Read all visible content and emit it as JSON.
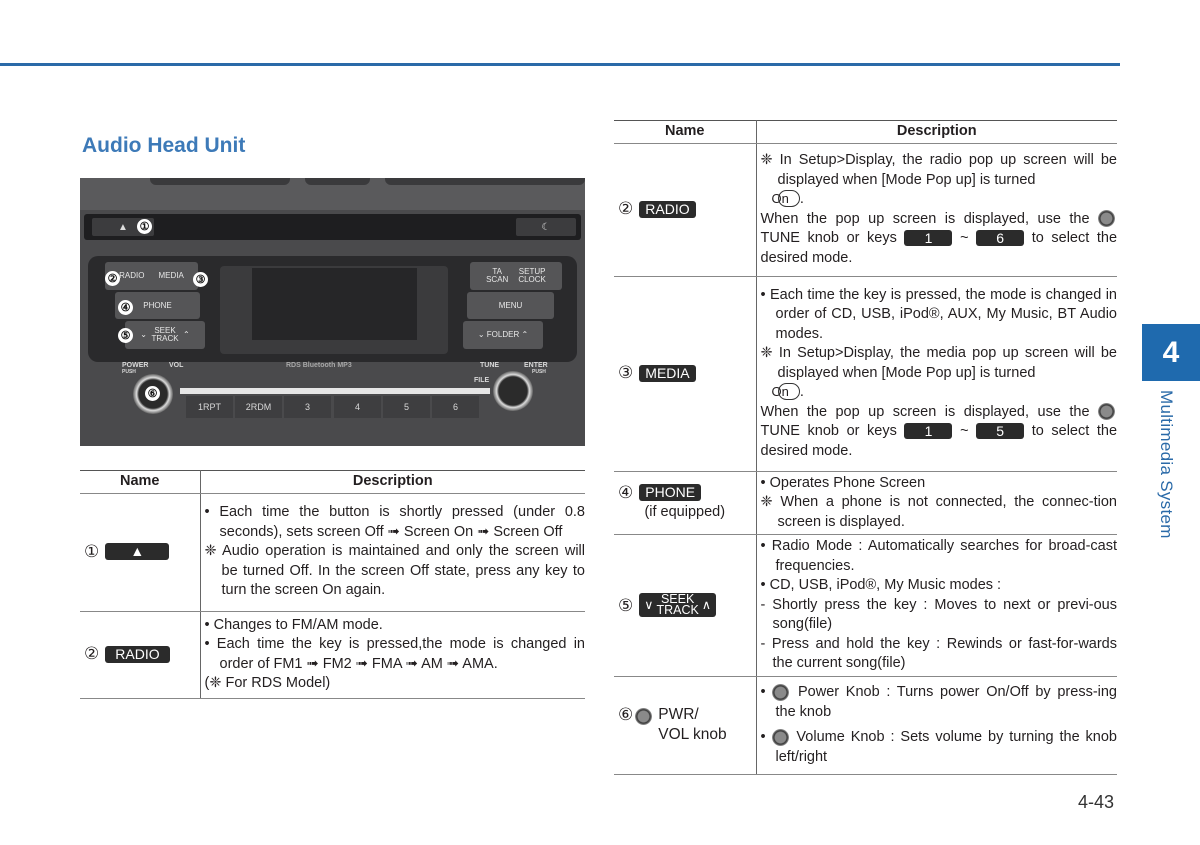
{
  "section_title": "Audio Head Unit",
  "chapter": {
    "number": "4",
    "label": "Multimedia System"
  },
  "page_number": "4-43",
  "colors": {
    "accent": "#2a6aa8",
    "tab": "#1f6aae",
    "key_badge": "#2b2b2b"
  },
  "photo": {
    "callouts": [
      "①",
      "②",
      "③",
      "④",
      "⑤",
      "⑥"
    ],
    "buttons": {
      "radio": "RADIO",
      "media": "MEDIA",
      "phone": "PHONE",
      "seek_top": "SEEK",
      "seek_bottom": "TRACK",
      "ta_top": "TA",
      "ta_bottom": "SCAN",
      "setup_top": "SETUP",
      "setup_bottom": "CLOCK",
      "menu": "MENU",
      "folder": "FOLDER"
    },
    "labels": {
      "power": "POWER",
      "power_push": "PUSH",
      "vol": "VOL",
      "brands": "RDS  Bluetooth  MP3",
      "tune": "TUNE",
      "enter": "ENTER",
      "enter_push": "PUSH",
      "file": "FILE"
    },
    "presets": [
      "1RPT",
      "2RDM",
      "3",
      "4",
      "5",
      "6"
    ]
  },
  "table_headers": {
    "name": "Name",
    "description": "Description"
  },
  "left_table": {
    "rows": [
      {
        "num": "①",
        "key": "▲",
        "lines": [
          "• Each time the button is shortly pressed (under 0.8 seconds), sets screen Off ➟ Screen On ➟ Screen Off",
          "❈ Audio operation is maintained and only the screen will be turned Off. In the screen Off state, press any key to turn the screen On again."
        ]
      },
      {
        "num": "②",
        "key": "RADIO",
        "lines": [
          "• Changes to FM/AM mode.",
          "• Each time the key is pressed,the mode is changed in order of FM1 ➟ FM2 ➟ FMA ➟ AM ➟ AMA.",
          "(❈ For RDS Model)"
        ]
      }
    ]
  },
  "right_table": {
    "radio": {
      "num": "②",
      "key": "RADIO",
      "note": "❈ In Setup>Display, the radio pop up screen will be displayed when [Mode Pop up] is turned",
      "on_pill": "On",
      "period": ".",
      "para_a": "When the pop up screen is displayed, use the",
      "para_b": "TUNE knob or keys",
      "key_from": "1",
      "tilde": "~",
      "key_to": "6",
      "para_c": "to select the desired mode."
    },
    "media": {
      "num": "③",
      "key": "MEDIA",
      "bullet": "• Each time the key is pressed, the mode is changed in order of CD, USB, iPod®, AUX, My Music, BT Audio modes.",
      "note": "❈ In Setup>Display, the media pop up screen will be displayed when [Mode Pop up] is turned",
      "on_pill": "On",
      "period": ".",
      "para_a": "When the pop up screen is displayed, use the",
      "para_b": "TUNE knob or keys",
      "key_from": "1",
      "tilde": "~",
      "key_to": "5",
      "para_c": "to select the desired mode."
    },
    "phone": {
      "num": "④",
      "key": "PHONE",
      "sub": "(if equipped)",
      "lines": [
        "• Operates Phone Screen",
        "❈ When a phone is not connected, the connec-tion screen is displayed."
      ]
    },
    "seek": {
      "num": "⑤",
      "key_top": "SEEK",
      "key_bottom": "TRACK",
      "down": "∨",
      "up": "∧",
      "bullets": [
        "• Radio Mode : Automatically searches for broad-cast frequencies.",
        "• CD, USB, iPod®, My Music modes :"
      ],
      "dashes": [
        "- Shortly press the key : Moves to next or previ-ous song(file)",
        "- Press and hold the key : Rewinds or fast-for-wards the current song(file)"
      ]
    },
    "knob": {
      "num": "⑥",
      "name_line1": "PWR/",
      "name_line2": "VOL knob",
      "items": [
        "Power Knob : Turns power On/Off by press-ing the knob",
        "Volume Knob : Sets volume by turning the knob left/right"
      ]
    }
  }
}
